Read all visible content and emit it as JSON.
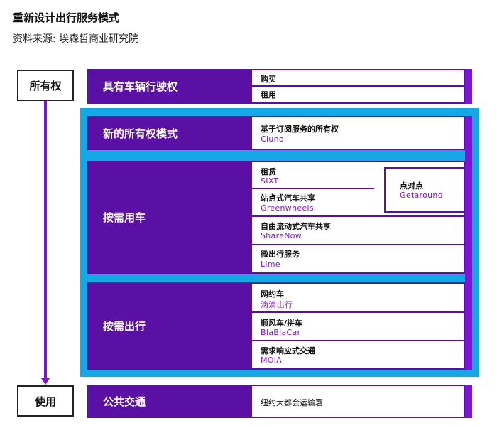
{
  "title": "重新设计出行服务模式",
  "source": "资料来源: 埃森哲商业研究院",
  "left_column": {
    "top": "所有权",
    "bottom": "使用"
  },
  "sections": {
    "ownership": {
      "label": "具有车辆行驶权",
      "items": [
        {
          "title": "购买"
        },
        {
          "title": "租用"
        }
      ]
    },
    "new_ownership": {
      "label": "新的所有权模式",
      "items": [
        {
          "title": "基于订阅服务的所有权",
          "example": "Cluno"
        }
      ]
    },
    "on_demand_car": {
      "label": "按需用车",
      "items": [
        {
          "title": "租赁",
          "example": "SIXT"
        },
        {
          "title": "站点式汽车共享",
          "example": "Greenwheels"
        },
        {
          "title": "自由流动式汽车共享",
          "example": "ShareNow"
        },
        {
          "title": "微出行服务",
          "example": "Lime"
        }
      ],
      "side_item": {
        "title": "点对点",
        "example": "Getaround"
      }
    },
    "on_demand_travel": {
      "label": "按需出行",
      "items": [
        {
          "title": "网约车",
          "example": "滴滴出行"
        },
        {
          "title": "顺风车/拼车",
          "example": "BlaBlaCar"
        },
        {
          "title": "需求响应式交通",
          "example": "MOIA"
        }
      ]
    },
    "public_transport": {
      "label": "公共交通",
      "items": [
        {
          "title": "纽约大都会运输署"
        }
      ]
    }
  },
  "colors": {
    "primary_purple": "#5a10a5",
    "accent_purple": "#7b14d6",
    "frame_cyan": "#14a8e6"
  }
}
